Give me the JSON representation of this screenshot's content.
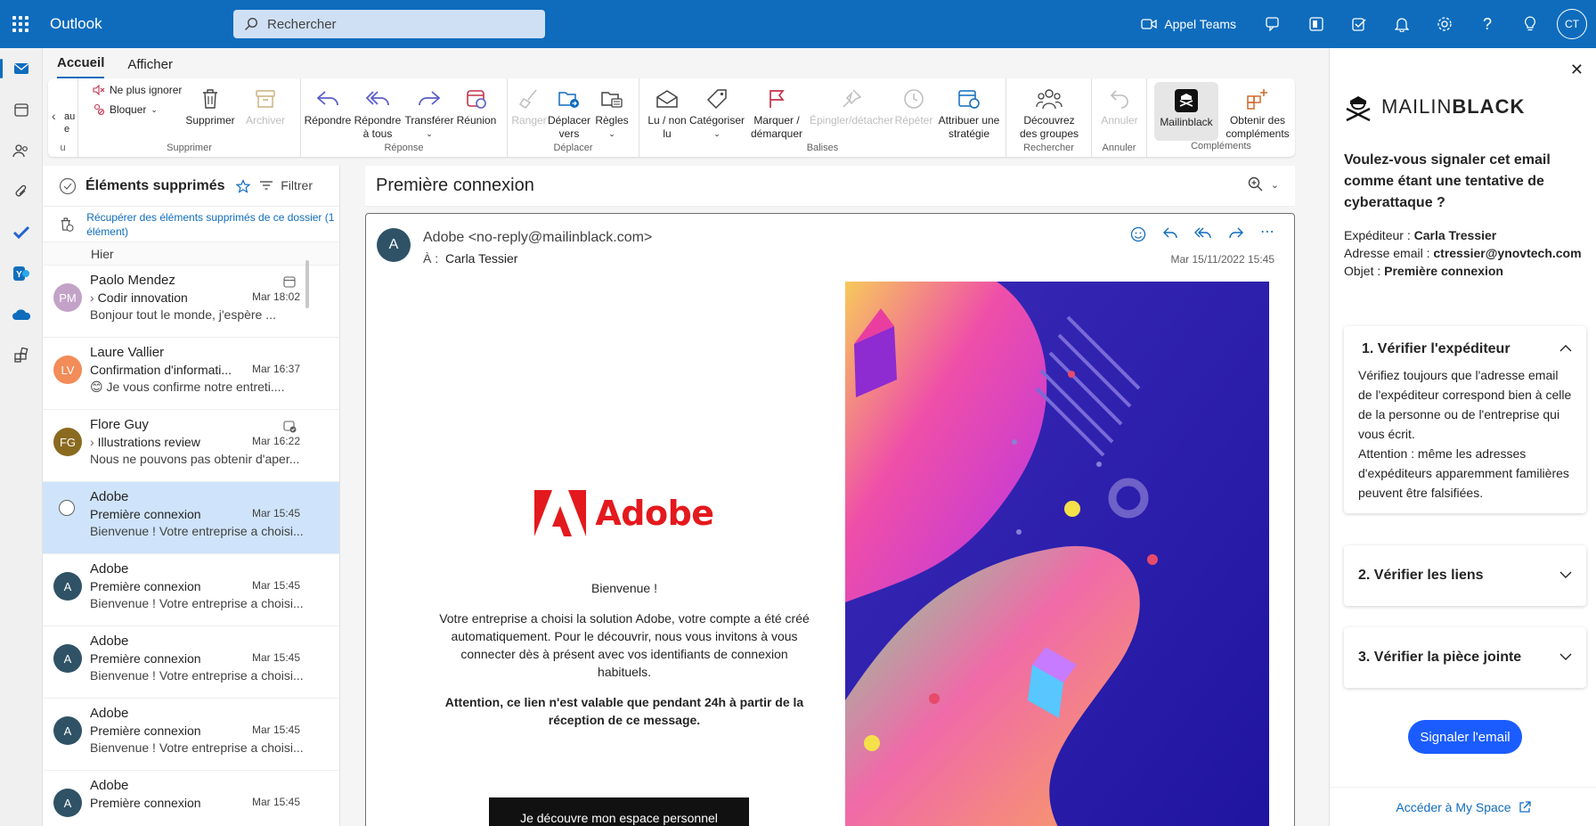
{
  "app": {
    "title": "Outlook"
  },
  "search": {
    "placeholder": "Rechercher"
  },
  "topbar": {
    "teams_label": "Appel Teams",
    "avatar_initials": "CT"
  },
  "tabs": [
    {
      "label": "Accueil",
      "active": true
    },
    {
      "label": "Afficher",
      "active": false
    }
  ],
  "ribbon": {
    "partial_label_1": "au",
    "partial_label_2": "e",
    "partial_group": "u",
    "ignore_label": "Ne plus ignorer",
    "block_label": "Bloquer",
    "delete_label": "Supprimer",
    "archive_label": "Archiver",
    "group_supprimer": "Supprimer",
    "reply_label": "Répondre",
    "reply_all_label": "Répondre à tous",
    "forward_label": "Transférer",
    "meeting_label": "Réunion",
    "group_reponse": "Réponse",
    "sweep_label": "Ranger",
    "move_label": "Déplacer vers",
    "rules_label": "Règles",
    "group_deplacer": "Déplacer",
    "read_label": "Lu / non lu",
    "categorize_label": "Catégoriser",
    "flag_label": "Marquer / démarquer",
    "pin_label": "Épingler/détacher",
    "snooze_label": "Répéter",
    "policy_label": "Attribuer une stratégie",
    "group_balises": "Balises",
    "groups_label": "Découvrez des groupes",
    "group_rechercher": "Rechercher",
    "undo_label": "Annuler",
    "group_annuler": "Annuler",
    "mailinblack_label": "Mailinblack",
    "addins_label": "Obtenir des compléments",
    "group_complements": "Compléments"
  },
  "folder": {
    "title": "Éléments supprimés",
    "filter_label": "Filtrer",
    "recover_text": "Récupérer des éléments supprimés de ce dossier (1 élément)",
    "day_header": "Hier"
  },
  "messages": [
    {
      "initials": "PM",
      "color": "#c3a2c8",
      "sender": "Paolo Mendez",
      "subject": "Codir innovation",
      "time": "Mar 18:02",
      "preview": "Bonjour tout le monde, j'espère ...",
      "selected": false
    },
    {
      "initials": "LV",
      "color": "#f28c58",
      "sender": "Laure Vallier",
      "subject": "Confirmation d'informati...",
      "time": "Mar 16:37",
      "preview": "😊 Je vous confirme notre entreti....",
      "selected": false
    },
    {
      "initials": "FG",
      "color": "#8a6a1f",
      "sender": "Flore Guy",
      "subject": "Illustrations review",
      "time": "Mar 16:22",
      "preview": "Nous ne pouvons pas obtenir d'aper...",
      "selected": false
    },
    {
      "initials": "",
      "color": "#ffffff",
      "sender": "Adobe",
      "subject": "Première connexion",
      "time": "Mar 15:45",
      "preview": "Bienvenue ! Votre entreprise a choisi...",
      "selected": true
    },
    {
      "initials": "A",
      "color": "#2f5266",
      "sender": "Adobe",
      "subject": "Première connexion",
      "time": "Mar 15:45",
      "preview": "Bienvenue ! Votre entreprise a choisi...",
      "selected": false
    },
    {
      "initials": "A",
      "color": "#2f5266",
      "sender": "Adobe",
      "subject": "Première connexion",
      "time": "Mar 15:45",
      "preview": "Bienvenue ! Votre entreprise a choisi...",
      "selected": false
    },
    {
      "initials": "A",
      "color": "#2f5266",
      "sender": "Adobe",
      "subject": "Première connexion",
      "time": "Mar 15:45",
      "preview": "Bienvenue ! Votre entreprise a choisi...",
      "selected": false
    },
    {
      "initials": "A",
      "color": "#2f5266",
      "sender": "Adobe",
      "subject": "Première connexion",
      "time": "Mar 15:45",
      "preview": "",
      "selected": false
    }
  ],
  "reading": {
    "title": "Première connexion",
    "sender_initial": "A",
    "from": "Adobe <no-reply@mailinblack.com>",
    "to_label": "À :",
    "to_name": "Carla Tessier",
    "date": "Mar 15/11/2022 15:45",
    "brand": "Adobe",
    "greeting": "Bienvenue !",
    "body": "Votre entreprise a choisi la solution Adobe, votre compte a été créé automatiquement. Pour le découvrir, nous vous invitons à vous connecter dès à présent avec vos identifiants de connexion habituels.",
    "warning": "Attention, ce lien n'est valable que pendant 24h à partir de la réception de ce message.",
    "cta": "Je découvre mon espace personnel"
  },
  "addin": {
    "brand_a": "MAILIN",
    "brand_b": "BLACK",
    "question": "Voulez-vous signaler cet email comme étant une tentative de cyberattaque ?",
    "sender_label": "Expéditeur :",
    "sender_value": "Carla Tressier",
    "email_label": "Adresse email :",
    "email_value": "ctressier@ynovtech.com",
    "subject_label": "Objet :",
    "subject_value": "Première connexion",
    "step1_title": "1. Vérifier l'expéditeur",
    "step1_body": "Vérifiez toujours que l'adresse email de l'expéditeur correspond bien à celle de la personne ou de l'entreprise qui vous écrit.",
    "step1_warning": "Attention : même les adresses d'expéditeurs apparemment familières peuvent être falsifiées.",
    "step2_title": "2. Vérifier les liens",
    "step3_title": "3. Vérifier la pièce jointe",
    "report_label": "Signaler l'email",
    "myspace_label": "Accéder à My Space"
  },
  "colors": {
    "brand": "#0f6cbd",
    "adobe": "#e4191d",
    "report": "#1a5cff"
  }
}
